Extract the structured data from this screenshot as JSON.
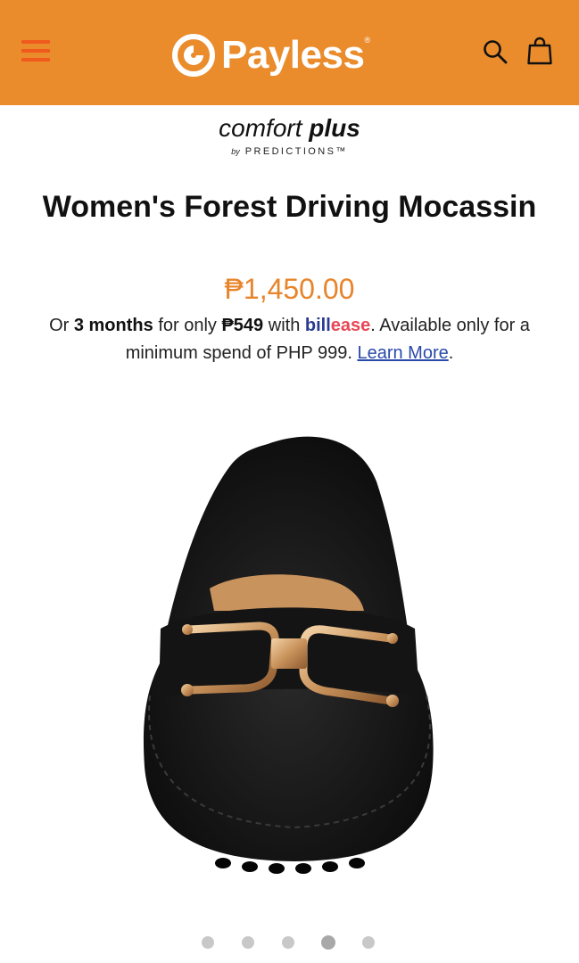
{
  "header": {
    "logo_text": "Payless",
    "logo_reg": "®",
    "menu_icon": "hamburger-menu-icon",
    "search_icon": "search-icon",
    "cart_icon": "shopping-bag-icon",
    "background_color": "#ea8c2c",
    "menu_color": "#f05a1c"
  },
  "brand": {
    "main_light": "comfort",
    "main_bold": "plus",
    "by": "by",
    "sub": "PREDICTIONS™"
  },
  "product": {
    "title": "Women's Forest Driving Mocassin",
    "price": "₱1,450.00",
    "price_color": "#e8842a"
  },
  "installment": {
    "or": "Or",
    "months": "3 months",
    "for_only": "for only",
    "amount": "₱549",
    "with": "with",
    "bill": "bill",
    "ease": "ease",
    "rest": ". Available only for a minimum spend of PHP 999.",
    "learn_more": "Learn More",
    "end": "."
  },
  "carousel": {
    "slide_count": 5,
    "active_index": 4
  }
}
